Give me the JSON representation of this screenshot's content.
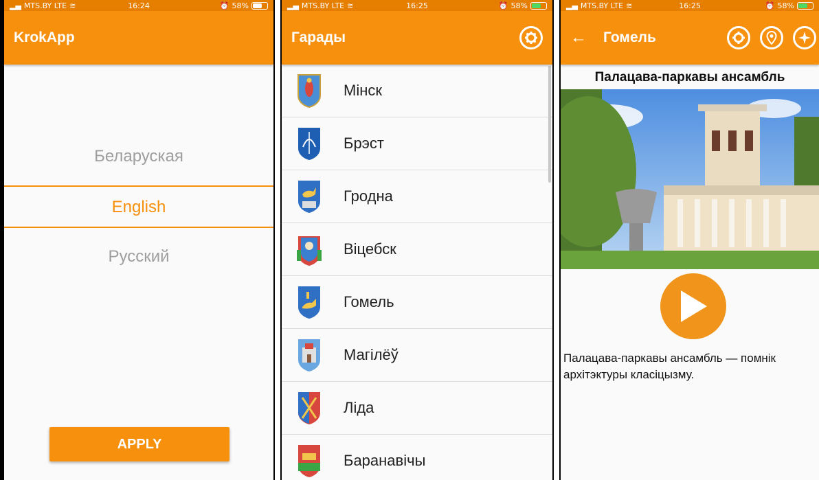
{
  "status": {
    "carrier": "MTS.BY LTE",
    "screen1_time": "16:24",
    "screen1_battery": "58%",
    "screen2_time": "16:25",
    "screen2_battery": "58%",
    "screen3_time": "16:25",
    "screen3_battery": "58%"
  },
  "screen1": {
    "app_title": "KrokApp",
    "languages": [
      "Беларуская",
      "English",
      "Русский"
    ],
    "selected_language": "English",
    "apply_label": "APPLY"
  },
  "screen2": {
    "title": "Гарады",
    "settings_icon": "gear-icon",
    "cities": [
      "Мінск",
      "Брэст",
      "Гродна",
      "Віцебск",
      "Гомель",
      "Магілёў",
      "Ліда",
      "Баранавічы"
    ]
  },
  "screen3": {
    "title": "Гомель",
    "back_icon": "arrow-left-icon",
    "icons": [
      "gear-icon",
      "location-pin-icon",
      "compass-icon"
    ],
    "place_title": "Палацава-паркавы ансамбль",
    "description": "Палацава-паркавы ансамбль — помнік архітэктуры класіцызму.",
    "play_icon": "play-icon"
  },
  "colors": {
    "accent": "#f7900d",
    "status_bar": "#e67e00",
    "play_button": "#f0941c"
  }
}
